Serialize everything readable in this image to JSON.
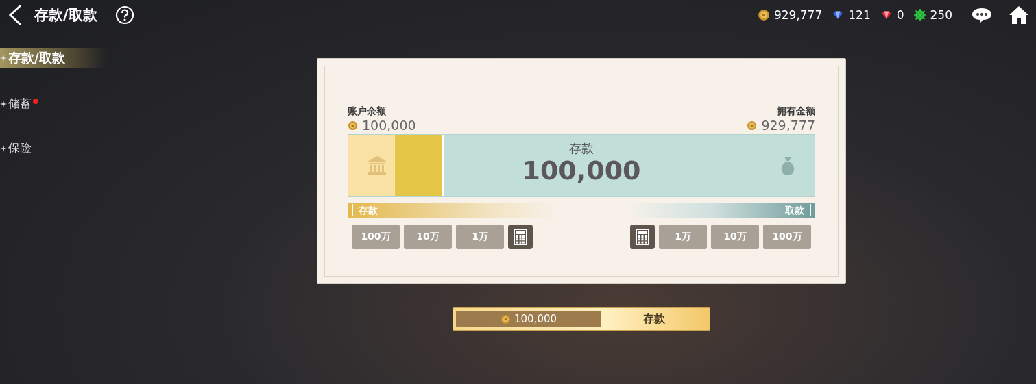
{
  "header": {
    "title": "存款/取款"
  },
  "currencies": [
    {
      "kind": "coin",
      "amount": "929,777"
    },
    {
      "kind": "blue-gem",
      "amount": "121"
    },
    {
      "kind": "red-gem",
      "amount": "0"
    },
    {
      "kind": "wheel",
      "amount": "250"
    }
  ],
  "sidebar": {
    "items": [
      {
        "label": "存款/取款",
        "selected": true,
        "badge": false
      },
      {
        "label": "储蓄",
        "selected": false,
        "badge": true
      },
      {
        "label": "保险",
        "selected": false,
        "badge": false
      }
    ]
  },
  "card": {
    "balance_label": "账户余额",
    "balance": "100,000",
    "owned_label": "拥有金额",
    "owned": "929,777",
    "slider": {
      "caption": "存款",
      "amount": "100,000",
      "level": 0.2,
      "left_label": "存款",
      "right_label": "取款"
    },
    "deposit_buttons": [
      "100万",
      "10万",
      "1万"
    ],
    "withdraw_buttons": [
      "1万",
      "10万",
      "100万"
    ]
  },
  "confirm": {
    "amount": "100,000",
    "label": "存款"
  }
}
